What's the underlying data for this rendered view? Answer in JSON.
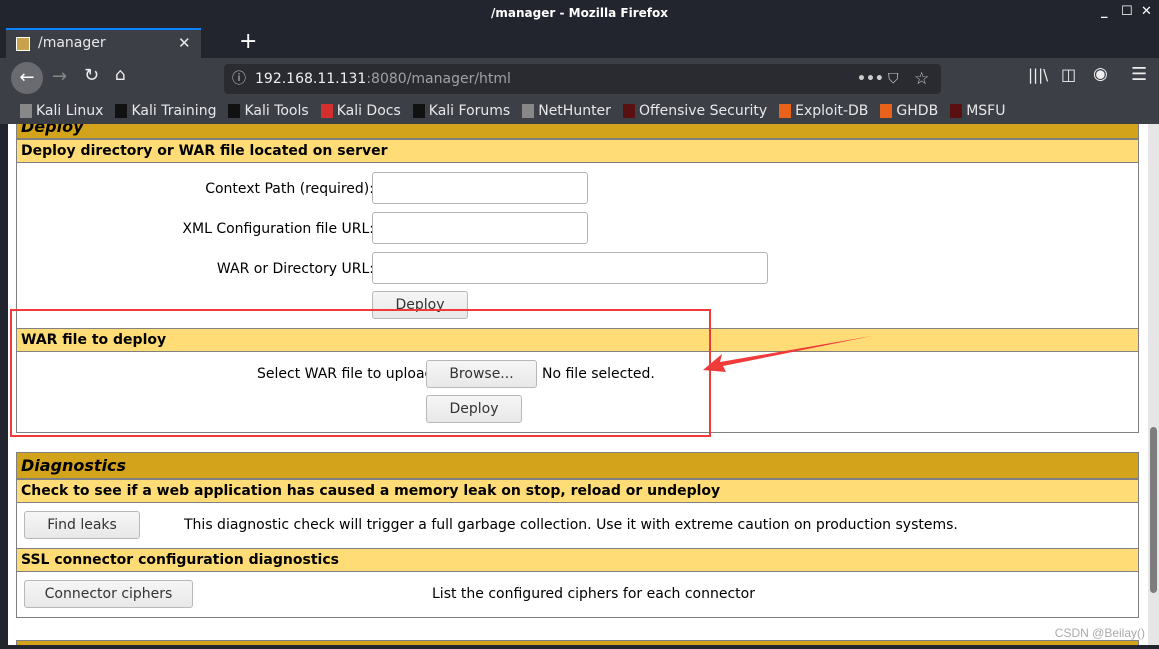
{
  "window": {
    "title": "/manager - Mozilla Firefox"
  },
  "tab": {
    "label": "/manager"
  },
  "url": {
    "host": "192.168.11.131",
    "rest": ":8080/manager/html"
  },
  "bookmarks": [
    {
      "label": "Kali Linux",
      "icon": "kali-dragon-icon"
    },
    {
      "label": "Kali Training",
      "icon": "kali-icon"
    },
    {
      "label": "Kali Tools",
      "icon": "kali-icon"
    },
    {
      "label": "Kali Docs",
      "icon": "docs-icon"
    },
    {
      "label": "Kali Forums",
      "icon": "kali-icon"
    },
    {
      "label": "NetHunter",
      "icon": "kali-dragon-icon"
    },
    {
      "label": "Offensive Security",
      "icon": "offsec-icon"
    },
    {
      "label": "Exploit-DB",
      "icon": "bug-icon"
    },
    {
      "label": "GHDB",
      "icon": "bug-icon"
    },
    {
      "label": "MSFU",
      "icon": "offsec-icon"
    }
  ],
  "deploy": {
    "title": "Deploy",
    "server_section": "Deploy directory or WAR file located on server",
    "context_path_label": "Context Path (required):",
    "xml_config_label": "XML Configuration file URL:",
    "war_dir_label": "WAR or Directory URL:",
    "deploy_button": "Deploy",
    "war_section": "WAR file to deploy",
    "select_label": "Select WAR file to upload",
    "browse_button": "Browse...",
    "no_file": "No file selected.",
    "war_deploy_button": "Deploy"
  },
  "diagnostics": {
    "title": "Diagnostics",
    "leak_section": "Check to see if a web application has caused a memory leak on stop, reload or undeploy",
    "find_leaks_button": "Find leaks",
    "find_leaks_desc": "This diagnostic check will trigger a full garbage collection. Use it with extreme caution on production systems.",
    "ssl_section": "SSL connector configuration diagnostics",
    "ciphers_button": "Connector ciphers",
    "ciphers_desc": "List the configured ciphers for each connector"
  },
  "watermark": "CSDN @Beilay()",
  "colors": {
    "header": "#d3a31c",
    "subheader": "#ffdc75",
    "annotation": "#f03b3b",
    "accent": "#0a84ff"
  }
}
